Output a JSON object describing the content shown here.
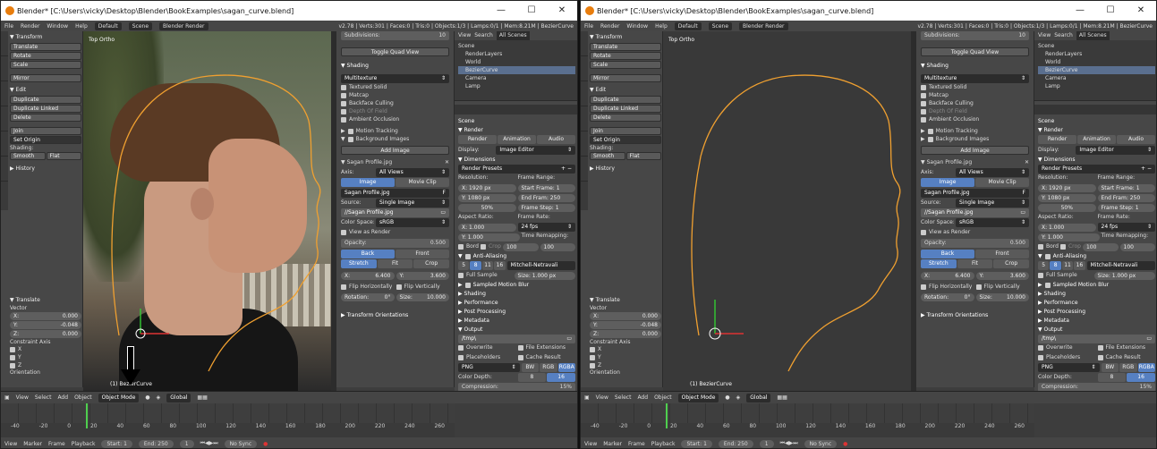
{
  "app": {
    "title": "Blender* [C:\\Users\\vicky\\Desktop\\Blender\\BookExamples\\sagan_curve.blend]",
    "window_controls": [
      "—",
      "☐",
      "✕"
    ]
  },
  "menubar": {
    "items": [
      "File",
      "Render",
      "Window",
      "Help"
    ],
    "layout": "Default",
    "scene": "Scene",
    "engine": "Blender Render",
    "stats": "v2.78 | Verts:301 | Faces:0 | Tris:0 | Objects:1/3 | Lamps:0/1 | Mem:8.21M | BezierCurve"
  },
  "toolshelf": {
    "transform_header": "▼ Transform",
    "transform_buttons": [
      "Translate",
      "Rotate",
      "Scale"
    ],
    "mirror": "Mirror",
    "edit_header": "▼ Edit",
    "edit_buttons": [
      "Duplicate",
      "Duplicate Linked",
      "Delete"
    ],
    "join": "Join",
    "set_origin": "Set Origin",
    "shading_label": "Shading:",
    "smooth": "Smooth",
    "flat": "Flat",
    "history": "▶ History",
    "op_header": "▼ Translate",
    "vector_label": "Vector",
    "vx_label": "X:",
    "vx": "0.000",
    "vy_label": "Y:",
    "vy": "-0.048",
    "vz_label": "Z:",
    "vz": "0.000",
    "constraint_label": "Constraint Axis",
    "axes": [
      "X",
      "Y",
      "Z"
    ],
    "orientation": "Orientation"
  },
  "viewport": {
    "view_label": "Top Ortho",
    "object_label": "(1) BezierCurve"
  },
  "npanel": {
    "subdivisions": "Subdivisions:",
    "subdivisions_val": "10",
    "toggle_quad": "Toggle Quad View",
    "shading_header": "▼ Shading",
    "shading_mode": "Multitexture",
    "shading_opts": [
      "Textured Solid",
      "Matcap",
      "Backface Culling",
      "Depth Of Field",
      "Ambient Occlusion"
    ],
    "motion_tracking": "Motion Tracking",
    "bg_images": "Background Images",
    "add_image": "Add Image",
    "image_name": "Sagan Profile.jpg",
    "axis_label": "Axis:",
    "axis_value": "All Views",
    "image_tab": "Image",
    "movieclip_tab": "Movie Clip",
    "image_block": "Sagan Profile.jpg",
    "fake_user": "F",
    "source_label": "Source:",
    "source_value": "Single Image",
    "filepath": "//Sagan Profile.jpg",
    "colorspace_label": "Color Space:",
    "colorspace_value": "sRGB",
    "view_as_render": "View as Render",
    "opacity_label": "Opacity:",
    "opacity_value": "0.500",
    "back": "Back",
    "front": "Front",
    "stretch": "Stretch",
    "fit": "Fit",
    "crop": "Crop",
    "x_label": "X:",
    "x_val": "6.400",
    "y_label": "Y:",
    "y_val": "3.600",
    "flip_h": "Flip Horizontally",
    "flip_v": "Flip Vertically",
    "rotation_label": "Rotation:",
    "rotation_val": "0°",
    "size_label": "Size:",
    "size_val": "10.000",
    "transform_orient": "▶ Transform Orientations"
  },
  "outliner": {
    "view": "View",
    "search": "Search",
    "filter": "All Scenes",
    "items": [
      "Scene",
      "RenderLayers",
      "World",
      "BezierCurve",
      "Camera",
      "Lamp"
    ]
  },
  "properties": {
    "scene_label": "Scene",
    "render_header": "▼ Render",
    "render_btn": "Render",
    "animation_btn": "Animation",
    "audio_btn": "Audio",
    "display_label": "Display:",
    "display_value": "Image Editor",
    "dimensions_header": "▼ Dimensions",
    "render_presets": "Render Presets",
    "resolution_label": "Resolution:",
    "frame_range_label": "Frame Range:",
    "res_x": "X:  1920 px",
    "res_y": "Y:  1080 px",
    "res_pct": "50%",
    "start_frame": "Start Frame: 1",
    "end_frame": "End Fram: 250",
    "frame_step": "Frame Step: 1",
    "aspect_label": "Aspect Ratio:",
    "frame_rate_label": "Frame Rate:",
    "aspect_x": "X:  1.000",
    "aspect_y": "Y:  1.000",
    "fps": "24 fps",
    "time_remap": "Time Remapping:",
    "border": "Bord",
    "crop": "Crop",
    "remap_old": "100",
    "remap_new": "100",
    "aa_header": "Anti-Aliasing",
    "aa_samples": [
      "5",
      "8",
      "11",
      "16"
    ],
    "aa_filter": "Mitchell-Netravali",
    "full_sample": "Full Sample",
    "aa_size": "Size: 1.000 px",
    "sampled_motion": "Sampled Motion Blur",
    "collapsed": [
      "▶ Shading",
      "▶ Performance",
      "▶ Post Processing",
      "▶ Metadata"
    ],
    "output_header": "▼ Output",
    "output_path": "/tmp\\",
    "overwrite": "Overwrite",
    "file_ext": "File Extensions",
    "placeholders": "Placeholders",
    "cache_result": "Cache Result",
    "format": "PNG",
    "bw": "BW",
    "rgb": "RGB",
    "rgba": "RGBA",
    "color_depth_label": "Color Depth:",
    "depth_8": "8",
    "depth_16": "16",
    "compression_label": "Compression:",
    "compression_value": "15%"
  },
  "header3d": {
    "view": "View",
    "select": "Select",
    "add": "Add",
    "object": "Object",
    "mode": "Object Mode",
    "orientation": "Global"
  },
  "timeline": {
    "ticks": [
      "-40",
      "-20",
      "0",
      "20",
      "40",
      "60",
      "80",
      "100",
      "120",
      "140",
      "160",
      "180",
      "200",
      "220",
      "240",
      "260"
    ],
    "view": "View",
    "marker": "Marker",
    "frame": "Frame",
    "playback": "Playback",
    "start": "Start:",
    "start_val": "1",
    "end": "End:",
    "end_val": "250",
    "current": "1",
    "sync": "No Sync"
  },
  "colors": {
    "accent": "#5680c2",
    "selection_orange": "#f0a030",
    "timeline_cursor": "#4fcf4f"
  }
}
